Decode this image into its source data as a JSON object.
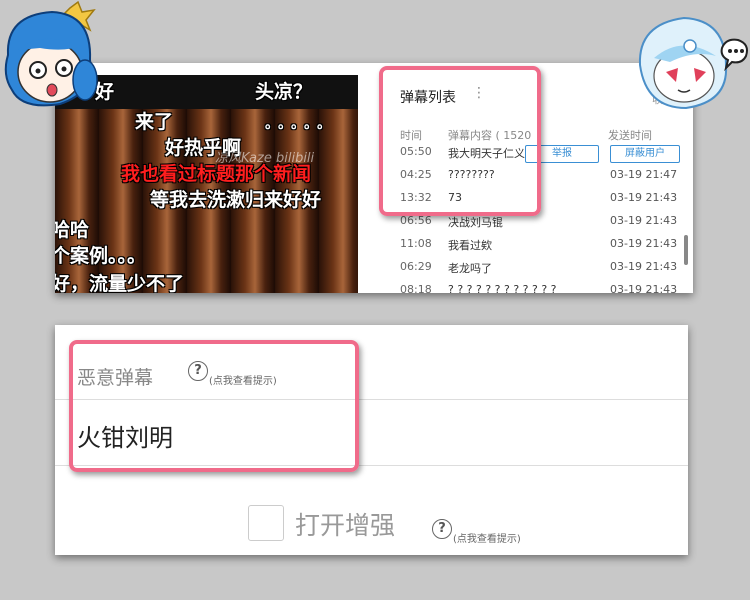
{
  "video": {
    "danmaku": [
      {
        "text": "好",
        "red": false
      },
      {
        "text": "头凉？",
        "red": false
      },
      {
        "text": "来了",
        "red": false
      },
      {
        "text": "好热乎啊",
        "red": false
      },
      {
        "text": "我也看过标题那个新闻",
        "red": true
      },
      {
        "text": "等我去洗漱归来好好",
        "red": false
      },
      {
        "text": "哈哈",
        "red": false
      },
      {
        "text": "个案例。。。",
        "red": false
      },
      {
        "text": "好，流量少不了",
        "red": false
      },
      {
        "text": "。。。。。",
        "red": false
      }
    ],
    "watermark": "凉风Kaze bilibili"
  },
  "danmaku_list": {
    "title": "弹幕列表",
    "more_icon": "⋮",
    "collapse": "收起",
    "columns": {
      "time": "时间",
      "content": "弹幕内容 ( 1520",
      "sent": "发送时间"
    },
    "actions": {
      "report": "举报",
      "block": "屏蔽用户"
    },
    "rows": [
      {
        "time": "05:50",
        "content": "我大明天子仁义",
        "date": ""
      },
      {
        "time": "04:25",
        "content": "????????",
        "date": "03-19 21:47"
      },
      {
        "time": "13:32",
        "content": "73",
        "date": "03-19 21:43"
      },
      {
        "time": "06:56",
        "content": "决战刘马锟",
        "date": "03-19 21:43"
      },
      {
        "time": "11:08",
        "content": "我看过欸",
        "date": "03-19 21:43"
      },
      {
        "time": "06:29",
        "content": "老龙吗了",
        "date": "03-19 21:43"
      },
      {
        "time": "08:18",
        "content": "? ? ? ? ? ? ? ? ? ? ? ?",
        "date": "03-19 21:43"
      }
    ]
  },
  "filter": {
    "malicious_label": "恶意弹幕",
    "help_icon": "?",
    "help_hint": "(点我查看提示)",
    "keyword": "火钳刘明",
    "enhance_label": "打开增强"
  },
  "colors": {
    "highlight": "#f06b8a",
    "accent": "#3a8fd4"
  }
}
